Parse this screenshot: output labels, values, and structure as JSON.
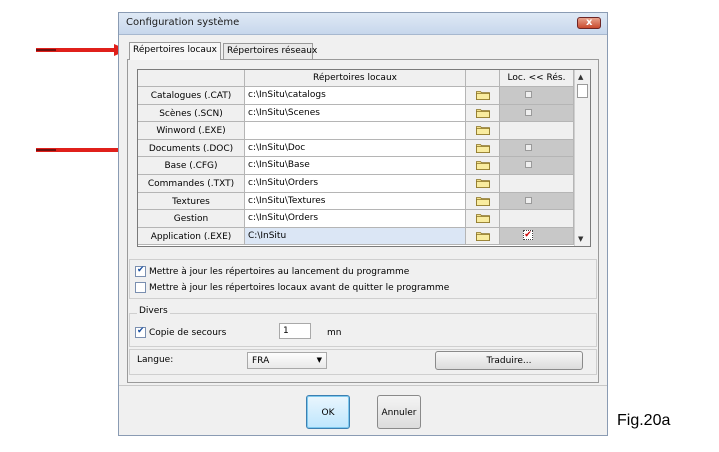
{
  "window": {
    "title": "Configuration système",
    "close_glyph": "x"
  },
  "tabs": [
    {
      "label": "Répertoires locaux",
      "active": true
    },
    {
      "label": "Répertoires réseaux",
      "active": false
    }
  ],
  "grid": {
    "columns": [
      "",
      "Répertoires locaux",
      "",
      "Loc. << Rés."
    ],
    "rows": [
      {
        "label": "Catalogues (.CAT)",
        "path": "c:\\InSitu\\catalogs",
        "loc": "unchecked"
      },
      {
        "label": "Scènes (.SCN)",
        "path": "c:\\InSitu\\Scenes",
        "loc": "unchecked"
      },
      {
        "label": "Winword (.EXE)",
        "path": "",
        "loc": "none"
      },
      {
        "label": "Documents (.DOC)",
        "path": "c:\\InSitu\\Doc",
        "loc": "unchecked"
      },
      {
        "label": "Base (.CFG)",
        "path": "c:\\InSitu\\Base",
        "loc": "unchecked"
      },
      {
        "label": "Commandes (.TXT)",
        "path": "c:\\InSitu\\Orders",
        "loc": "none"
      },
      {
        "label": "Textures",
        "path": "c:\\InSitu\\Textures",
        "loc": "unchecked"
      },
      {
        "label": "Gestion",
        "path": "c:\\InSitu\\Orders",
        "loc": "none"
      },
      {
        "label": "Application (.EXE)",
        "path": "C:\\InSitu",
        "loc": "checked"
      }
    ]
  },
  "options": {
    "update_on_start": {
      "label": "Mettre à jour les répertoires au lancement du programme",
      "checked": true
    },
    "update_on_quit": {
      "label": "Mettre à jour les répertoires locaux avant de quitter le programme",
      "checked": false
    }
  },
  "divers": {
    "group_label": "Divers",
    "backup_label": "Copie de secours",
    "backup_checked": true,
    "backup_value": "1",
    "backup_unit": "mn"
  },
  "language": {
    "label": "Langue:",
    "value": "FRA",
    "translate_label": "Traduire..."
  },
  "buttons": {
    "ok": "OK",
    "cancel": "Annuler"
  },
  "figure_label": "Fig.20a",
  "colors": {
    "arrow": "#e0201b",
    "titlebar": "#c7d7ec"
  }
}
